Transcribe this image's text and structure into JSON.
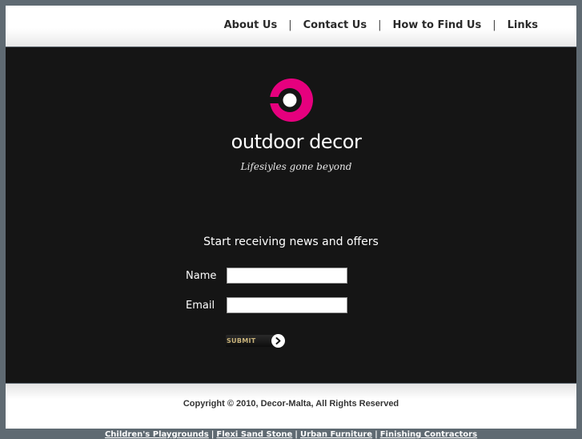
{
  "nav": {
    "items": [
      {
        "label": "About Us"
      },
      {
        "label": "Contact Us"
      },
      {
        "label": "How to Find Us"
      },
      {
        "label": "Links"
      }
    ],
    "separator": "|"
  },
  "brand": {
    "logo_text": "outdoor decor",
    "tagline": "Lifesiyles gone beyond",
    "accent_color": "#e6007e"
  },
  "signup": {
    "headline": "Start receiving news and offers",
    "name_label": "Name",
    "name_value": "",
    "email_label": "Email",
    "email_value": "",
    "submit_label": "SUBMIT"
  },
  "footer": {
    "copyright": "Copyright © 2010, Decor-Malta, All Rights Reserved",
    "links": [
      {
        "label": "Children's Playgrounds"
      },
      {
        "label": "Flexi Sand Stone"
      },
      {
        "label": "Urban Furniture"
      },
      {
        "label": "Finishing Contractors"
      }
    ],
    "separator": "|"
  }
}
